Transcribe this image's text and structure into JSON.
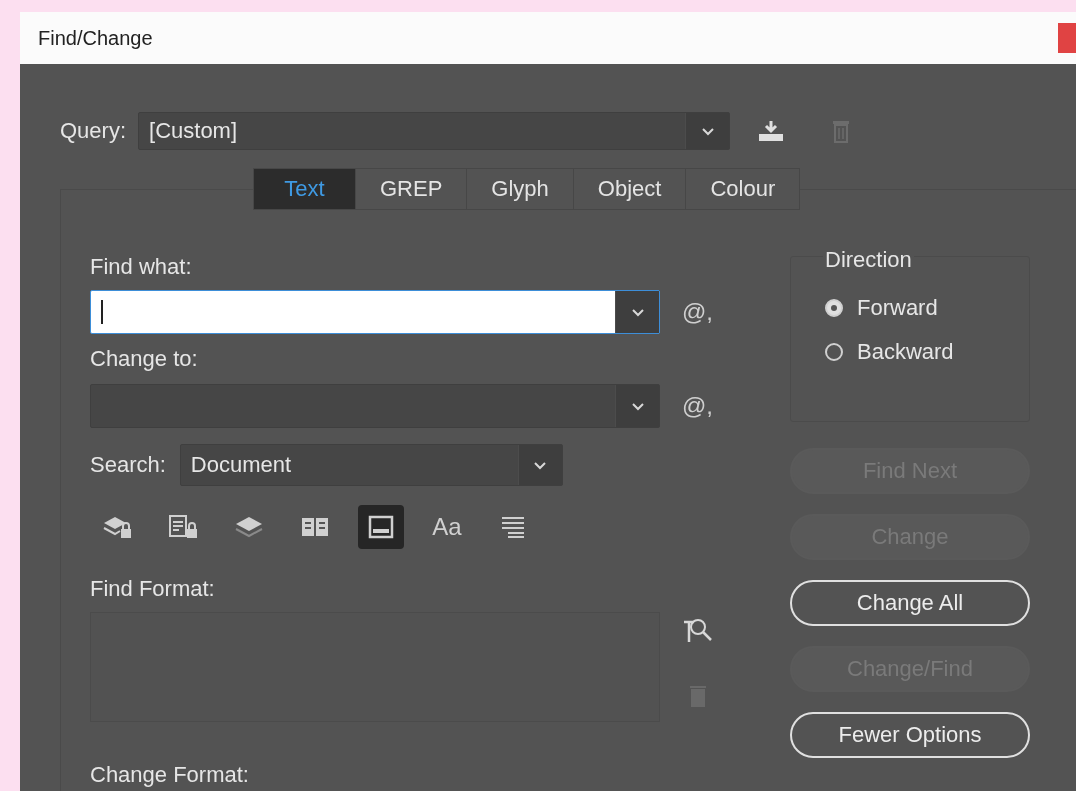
{
  "window": {
    "title": "Find/Change"
  },
  "query": {
    "label": "Query:",
    "value": "[Custom]"
  },
  "tabs": [
    {
      "label": "Text",
      "selected": true
    },
    {
      "label": "GREP",
      "selected": false
    },
    {
      "label": "Glyph",
      "selected": false
    },
    {
      "label": "Object",
      "selected": false
    },
    {
      "label": "Colour",
      "selected": false
    }
  ],
  "find_what": {
    "label": "Find what:",
    "focused": true,
    "special_characters": "@,"
  },
  "change_to": {
    "label": "Change to:",
    "focused": false,
    "special_characters": "@,"
  },
  "search": {
    "label": "Search:",
    "value": "Document"
  },
  "search_options": [
    {
      "kind": "locked-layers",
      "selected": false
    },
    {
      "kind": "locked-stories",
      "selected": false
    },
    {
      "kind": "hidden-layers",
      "selected": false
    },
    {
      "kind": "master-pages",
      "selected": false
    },
    {
      "kind": "footnotes",
      "selected": true
    },
    {
      "kind": "case",
      "label": "Aa",
      "selected": false
    },
    {
      "kind": "whole-word",
      "selected": false
    }
  ],
  "find_format": {
    "label": "Find Format:"
  },
  "change_format": {
    "label": "Change Format:"
  },
  "direction": {
    "label": "Direction",
    "options": [
      {
        "label": "Forward",
        "selected": true
      },
      {
        "label": "Backward",
        "selected": false
      }
    ]
  },
  "buttons": [
    {
      "label": "Find Next",
      "disabled": true
    },
    {
      "label": "Change",
      "disabled": true
    },
    {
      "label": "Change All",
      "disabled": false
    },
    {
      "label": "Change/Find",
      "disabled": true
    },
    {
      "label": "Fewer Options",
      "disabled": false
    }
  ]
}
